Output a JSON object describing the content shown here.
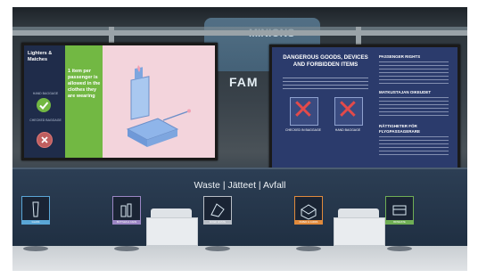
{
  "left_screen": {
    "title": "Lighters & Matches",
    "hand_baggage_label": "HAND BAGGAGE",
    "checked_baggage_label": "CHECKED BAGGAGE",
    "rule_text": "1 item per passenger is allowed in the clothes they are wearing"
  },
  "right_screen": {
    "heading": "DANGEROUS GOODS, DEVICES AND FORBIDDEN ITEMS",
    "checked_caption": "CHECKED IN BAGGAGE",
    "hand_caption": "HAND BAGGAGE",
    "passenger_rights": "PASSENGER RIGHTS",
    "matkustajan": "MATKUSTAJAN OIKEUDET",
    "rattigheter": "RÄTTIGHETER FÖR FLYGPASSAGERARE"
  },
  "background_sign": {
    "text": "MINIONS",
    "fam": "FAM"
  },
  "waste_station": {
    "title": "Waste | Jätteet | Avfall",
    "bins": [
      {
        "label": "GLASS",
        "color": "#5aa6d6"
      },
      {
        "label": "BOTTLES & CANS",
        "color": "#9b86c4"
      },
      {
        "label": "MIXED WASTE",
        "color": "#b8bec6"
      },
      {
        "label": "PAPER & CARDS",
        "color": "#e08a3c"
      },
      {
        "label": "BIOWASTE",
        "color": "#6fae55"
      }
    ]
  }
}
